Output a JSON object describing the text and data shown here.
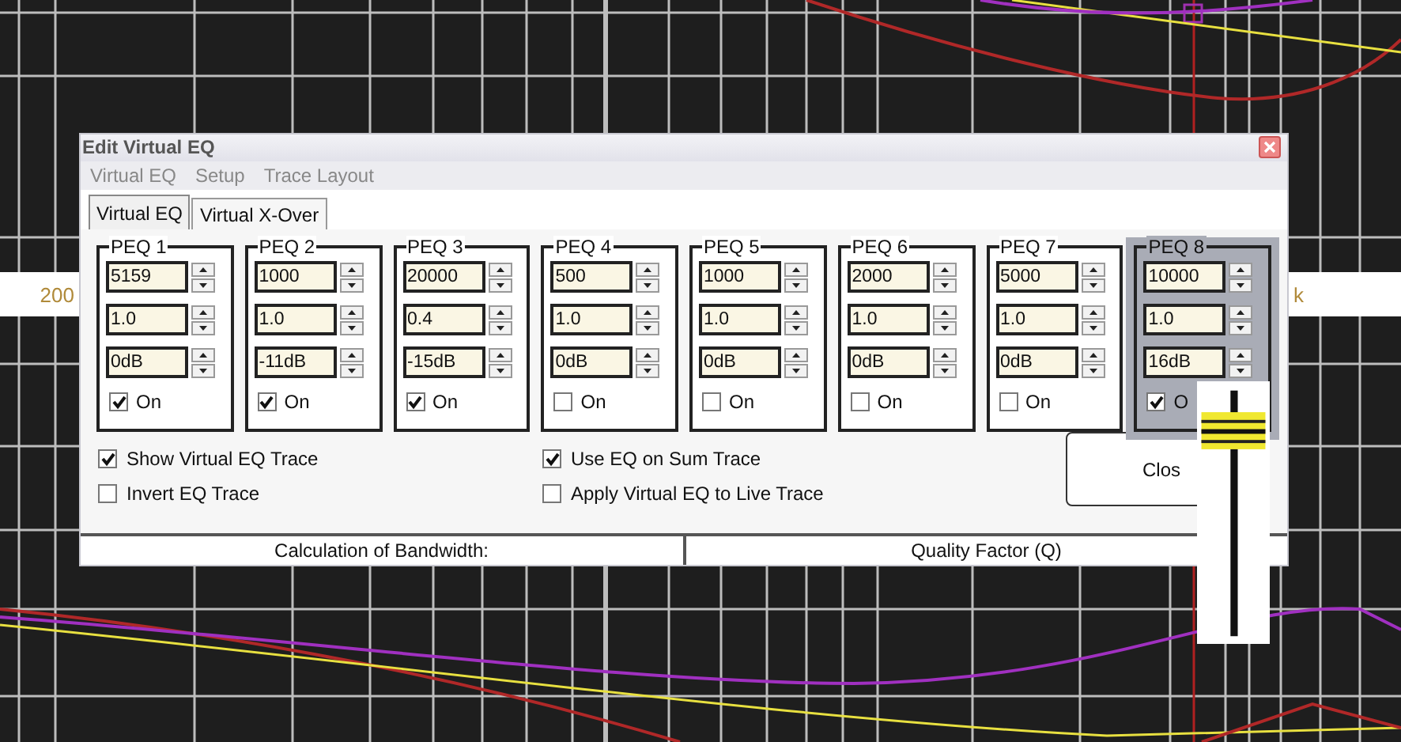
{
  "graph": {
    "axis_labels": [
      "200",
      "k"
    ]
  },
  "window": {
    "title": "Edit Virtual EQ"
  },
  "menu": [
    "Virtual EQ",
    "Setup",
    "Trace Layout"
  ],
  "tabs": [
    {
      "label": "Virtual EQ",
      "selected": true
    },
    {
      "label": "Virtual X-Over",
      "selected": false
    }
  ],
  "filters": [
    {
      "label": "PEQ 1",
      "selected": false,
      "frequency": "5159",
      "q": "1.0",
      "gain": "0dB",
      "on": true,
      "on_label": "On"
    },
    {
      "label": "PEQ 2",
      "selected": false,
      "frequency": "1000",
      "q": "1.0",
      "gain": "-11dB",
      "on": true,
      "on_label": "On"
    },
    {
      "label": "PEQ 3",
      "selected": false,
      "frequency": "20000",
      "q": "0.4",
      "gain": "-15dB",
      "on": true,
      "on_label": "On"
    },
    {
      "label": "PEQ 4",
      "selected": false,
      "frequency": "500",
      "q": "1.0",
      "gain": "0dB",
      "on": false,
      "on_label": "On"
    },
    {
      "label": "PEQ 5",
      "selected": false,
      "frequency": "1000",
      "q": "1.0",
      "gain": "0dB",
      "on": false,
      "on_label": "On"
    },
    {
      "label": "PEQ 6",
      "selected": false,
      "frequency": "2000",
      "q": "1.0",
      "gain": "0dB",
      "on": false,
      "on_label": "On"
    },
    {
      "label": "PEQ 7",
      "selected": false,
      "frequency": "5000",
      "q": "1.0",
      "gain": "0dB",
      "on": false,
      "on_label": "On"
    },
    {
      "label": "PEQ 8",
      "selected": true,
      "frequency": "10000",
      "q": "1.0",
      "gain": "16dB",
      "on": true,
      "on_label": "O"
    }
  ],
  "options": [
    {
      "label": "Show Virtual EQ Trace",
      "checked": true
    },
    {
      "label": "Use EQ on Sum Trace",
      "checked": true
    },
    {
      "label": "Invert EQ Trace",
      "checked": false
    },
    {
      "label": "Apply Virtual EQ to Live Trace",
      "checked": false
    }
  ],
  "close_button": "Clos",
  "status_bar": [
    "Calculation of Bandwidth:",
    "Quality Factor (Q)"
  ]
}
